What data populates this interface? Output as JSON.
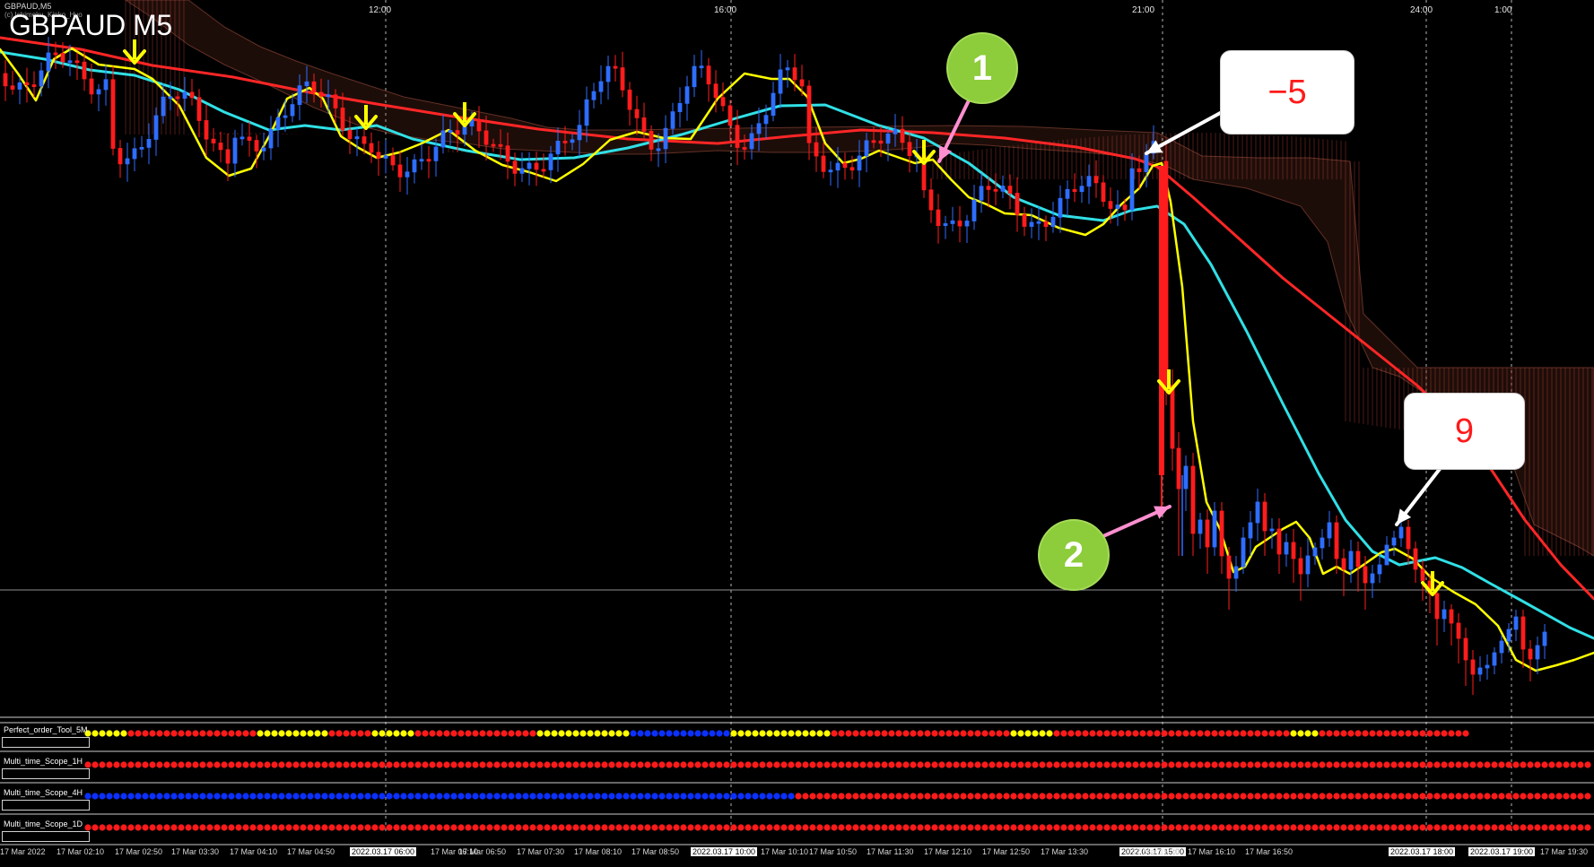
{
  "chart_data": {
    "type": "line",
    "title": "GBPAUD M5",
    "xlabel": "",
    "ylabel": "",
    "x_ticks_top": [
      "12:00",
      "16:00",
      "21:00",
      "24:00",
      "1:00"
    ],
    "x_ticks_bottom": [
      "17 Mar 2022",
      "17 Mar 02:10",
      "17 Mar 02:50",
      "17 Mar 03:30",
      "17 Mar 04:10",
      "17 Mar 04:50",
      "2022.03.17 06:00",
      "17 Mar 06:10",
      "17 Mar 06:50",
      "17 Mar 07:30",
      "17 Mar 08:10",
      "17 Mar 08:50",
      "2022.03.17 10:00",
      "17 Mar 10:10",
      "17 Mar 10:50",
      "17 Mar 11:30",
      "17 Mar 12:10",
      "17 Mar 12:50",
      "17 Mar 13:30",
      "2022.03.17 15:00",
      "17 Mar 15:30",
      "17 Mar 16:10",
      "17 Mar 16:50",
      "2022.03.17 18:00",
      "2022.03.17 19:00",
      "17 Mar 19:30"
    ],
    "series": []
  },
  "annotations": {
    "badges": [
      "1",
      "2"
    ],
    "callouts": [
      "−5",
      "9"
    ]
  },
  "panels": [
    {
      "label": "Perfect_order_Tool_5M"
    },
    {
      "label": "Multi_time_Scope_1H"
    },
    {
      "label": "Multi_time_Scope_4H"
    },
    {
      "label": "Multi_time_Scope_1D"
    }
  ],
  "colors": {
    "background": "#000000",
    "red_line": "#ff2626",
    "cyan_line": "#30e0e6",
    "yellow_line": "#ffff00",
    "bull_candle": "#2f6dff",
    "bear_candle": "#ff1c1c",
    "cloud": "#c4783a",
    "badge_green": "#8dcc3a"
  },
  "chart_header": {
    "mini_title": "GBPAUD,M5",
    "sub_title": "(c) Ichimoku_Kinko_Hyo"
  }
}
